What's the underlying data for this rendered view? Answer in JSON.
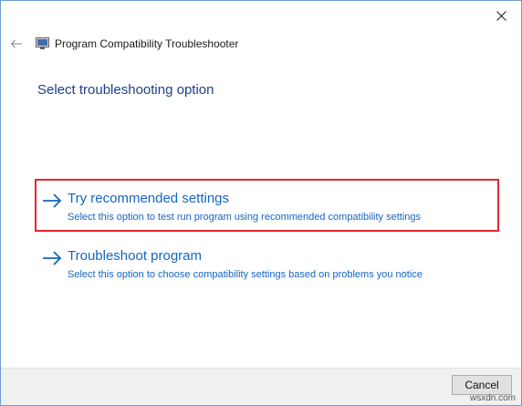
{
  "window": {
    "title": "Program Compatibility Troubleshooter",
    "close_icon": "close-icon",
    "back_icon": "back-arrow-icon",
    "app_icon": "troubleshooter-icon"
  },
  "main": {
    "heading": "Select troubleshooting option",
    "options": [
      {
        "icon": "arrow-right-icon",
        "title": "Try recommended settings",
        "description": "Select this option to test run program using recommended compatibility settings",
        "highlighted": true
      },
      {
        "icon": "arrow-right-icon",
        "title": "Troubleshoot program",
        "description": "Select this option to choose compatibility settings based on problems you notice",
        "highlighted": false
      }
    ]
  },
  "footer": {
    "cancel_label": "Cancel"
  },
  "watermark": "wsxdn.com",
  "colors": {
    "link": "#1565c0",
    "heading": "#1e3f8a",
    "highlight_border": "#e3262e",
    "footer_bg": "#f0f0f0"
  }
}
